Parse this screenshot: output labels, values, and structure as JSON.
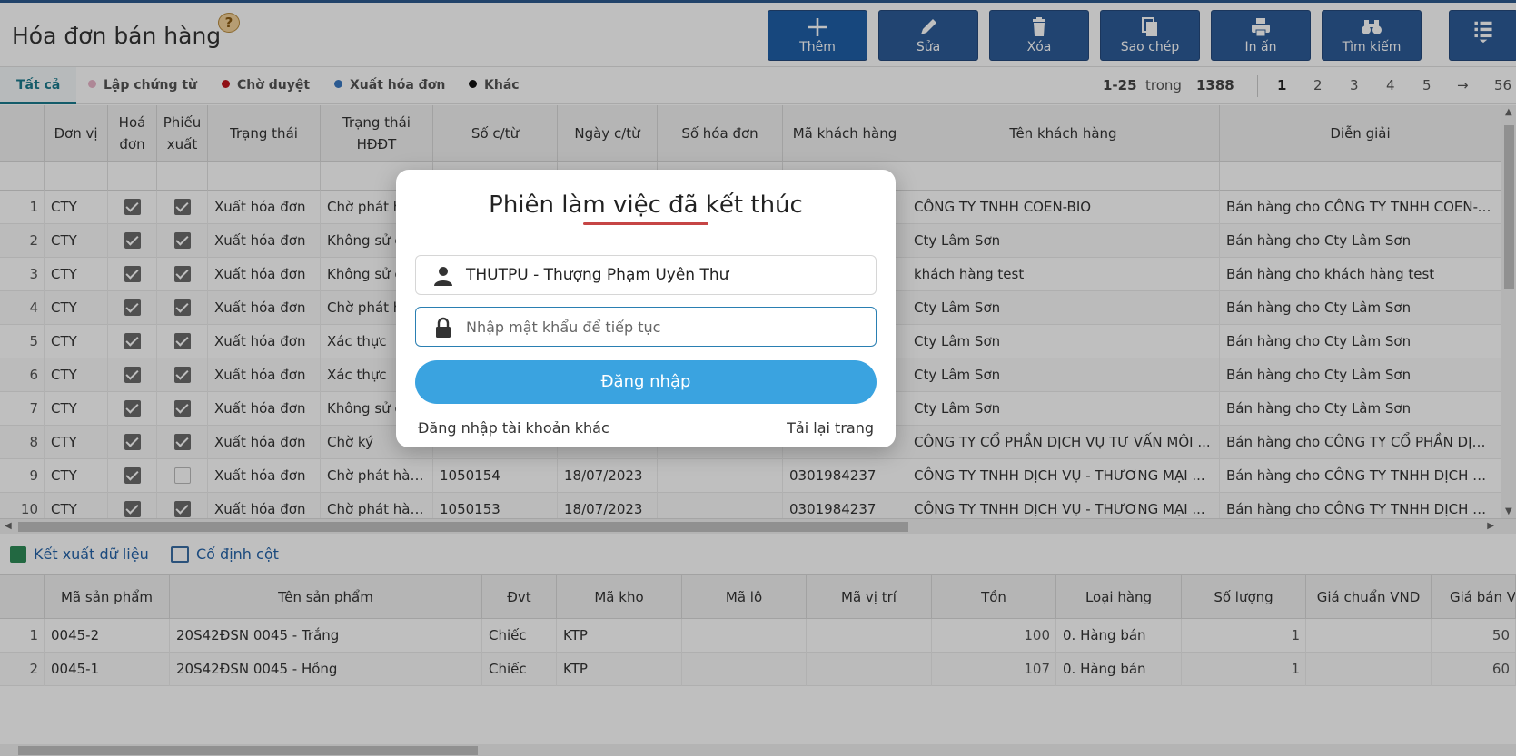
{
  "header": {
    "title": "Hóa đơn bán hàng",
    "help_glyph": "?",
    "toolbar": [
      {
        "label": "Thêm",
        "icon": "plus-icon"
      },
      {
        "label": "Sửa",
        "icon": "pencil-icon"
      },
      {
        "label": "Xóa",
        "icon": "trash-icon"
      },
      {
        "label": "Sao chép",
        "icon": "copy-icon"
      },
      {
        "label": "In ấn",
        "icon": "printer-icon"
      },
      {
        "label": "Tìm kiếm",
        "icon": "binoculars-icon"
      }
    ],
    "menu_icon": "menu-icon"
  },
  "tabs": {
    "all": "Tất cả",
    "items": [
      {
        "label": "Lập chứng từ",
        "color": "#e8b4c8"
      },
      {
        "label": "Chờ duyệt",
        "color": "#c0141c"
      },
      {
        "label": "Xuất hóa đơn",
        "color": "#3a78c2"
      },
      {
        "label": "Khác",
        "color": "#111111"
      }
    ]
  },
  "pager": {
    "range": "1-25",
    "of": "trong",
    "total": "1388",
    "pages": [
      "1",
      "2",
      "3",
      "4",
      "5"
    ],
    "next": "→",
    "last": "56"
  },
  "grid": {
    "headers": [
      "Đơn vị",
      "Hoá đơn",
      "Phiếu xuất",
      "Trạng thái",
      "Trạng thái HĐĐT",
      "Số c/từ",
      "Ngày c/từ",
      "Số hóa đơn",
      "Mã khách hàng",
      "Tên khách hàng",
      "Diễn giải"
    ],
    "rows": [
      {
        "no": "1",
        "unit": "CTY",
        "invoice": true,
        "export": true,
        "status": "Xuất hóa đơn",
        "einv": "Chờ phát h",
        "doc": "",
        "date": "",
        "invno": "",
        "cust_code": "",
        "cust_name": "CÔNG TY TNHH COEN-BIO",
        "desc": "Bán hàng cho CÔNG TY TNHH COEN-BIC"
      },
      {
        "no": "2",
        "unit": "CTY",
        "invoice": true,
        "export": true,
        "status": "Xuất hóa đơn",
        "einv": "Không sử c",
        "doc": "",
        "date": "",
        "invno": "",
        "cust_code": "",
        "cust_name": "Cty Lâm Sơn",
        "desc": "Bán hàng cho Cty Lâm Sơn"
      },
      {
        "no": "3",
        "unit": "CTY",
        "invoice": true,
        "export": true,
        "status": "Xuất hóa đơn",
        "einv": "Không sử c",
        "doc": "",
        "date": "",
        "invno": "",
        "cust_code": "",
        "cust_name": "khách hàng test",
        "desc": "Bán hàng cho khách hàng test"
      },
      {
        "no": "4",
        "unit": "CTY",
        "invoice": true,
        "export": true,
        "status": "Xuất hóa đơn",
        "einv": "Chờ phát h",
        "doc": "",
        "date": "",
        "invno": "",
        "cust_code": "",
        "cust_name": "Cty Lâm Sơn",
        "desc": "Bán hàng cho Cty Lâm Sơn"
      },
      {
        "no": "5",
        "unit": "CTY",
        "invoice": true,
        "export": true,
        "status": "Xuất hóa đơn",
        "einv": "Xác thực",
        "doc": "",
        "date": "",
        "invno": "",
        "cust_code": "",
        "cust_name": "Cty Lâm Sơn",
        "desc": "Bán hàng cho Cty Lâm Sơn"
      },
      {
        "no": "6",
        "unit": "CTY",
        "invoice": true,
        "export": true,
        "status": "Xuất hóa đơn",
        "einv": "Xác thực",
        "doc": "",
        "date": "",
        "invno": "",
        "cust_code": "",
        "cust_name": "Cty Lâm Sơn",
        "desc": "Bán hàng cho Cty Lâm Sơn"
      },
      {
        "no": "7",
        "unit": "CTY",
        "invoice": true,
        "export": true,
        "status": "Xuất hóa đơn",
        "einv": "Không sử c",
        "doc": "",
        "date": "",
        "invno": "",
        "cust_code": "",
        "cust_name": "Cty Lâm Sơn",
        "desc": "Bán hàng cho Cty Lâm Sơn"
      },
      {
        "no": "8",
        "unit": "CTY",
        "invoice": true,
        "export": true,
        "status": "Xuất hóa đơn",
        "einv": "Chờ ký",
        "doc": "",
        "date": "",
        "invno": "",
        "cust_code": "",
        "cust_name": "CÔNG TY CỔ PHẦN DỊCH VỤ TƯ VẤN MÔI ...",
        "desc": "Bán hàng cho CÔNG TY CỔ PHẦN DỊCH V"
      },
      {
        "no": "9",
        "unit": "CTY",
        "invoice": true,
        "export": false,
        "status": "Xuất hóa đơn",
        "einv": "Chờ phát hành",
        "doc": "1050154",
        "date": "18/07/2023",
        "invno": "",
        "cust_code": "0301984237",
        "cust_name": "CÔNG TY TNHH DỊCH VỤ - THƯƠNG MẠI ...",
        "desc": "Bán hàng cho CÔNG TY TNHH DỊCH VỤ -"
      },
      {
        "no": "10",
        "unit": "CTY",
        "invoice": true,
        "export": true,
        "status": "Xuất hóa đơn",
        "einv": "Chờ phát hành",
        "doc": "1050153",
        "date": "18/07/2023",
        "invno": "",
        "cust_code": "0301984237",
        "cust_name": "CÔNG TY TNHH DỊCH VỤ - THƯƠNG MẠI ...",
        "desc": "Bán hàng cho CÔNG TY TNHH DỊCH VỤ -"
      }
    ]
  },
  "actions": {
    "export": "Kết xuất dữ liệu",
    "freeze": "Cố định cột"
  },
  "detail": {
    "headers": [
      "Mã sản phẩm",
      "Tên sản phẩm",
      "Đvt",
      "Mã kho",
      "Mã lô",
      "Mã vị trí",
      "Tồn",
      "Loại hàng",
      "Số lượng",
      "Giá chuẩn VND",
      "Giá bán V"
    ],
    "rows": [
      {
        "no": "1",
        "code": "0045-2",
        "name": "20S42ĐSN 0045 - Trắng",
        "unit": "Chiếc",
        "wh": "KTP",
        "lot": "",
        "loc": "",
        "stock": "100",
        "type": "0. Hàng bán",
        "qty": "1",
        "std": "",
        "price": "50"
      },
      {
        "no": "2",
        "code": "0045-1",
        "name": "20S42ĐSN 0045 - Hồng",
        "unit": "Chiếc",
        "wh": "KTP",
        "lot": "",
        "loc": "",
        "stock": "107",
        "type": "0. Hàng bán",
        "qty": "1",
        "std": "",
        "price": "60"
      }
    ]
  },
  "modal": {
    "title": "Phiên làm việc đã kết thúc",
    "user": "THUTPU - Thượng Phạm Uyên Thư",
    "password_placeholder": "Nhập mật khẩu để tiếp tục",
    "login": "Đăng nhập",
    "other_account": "Đăng nhập tài khoản khác",
    "reload": "Tải lại trang"
  }
}
